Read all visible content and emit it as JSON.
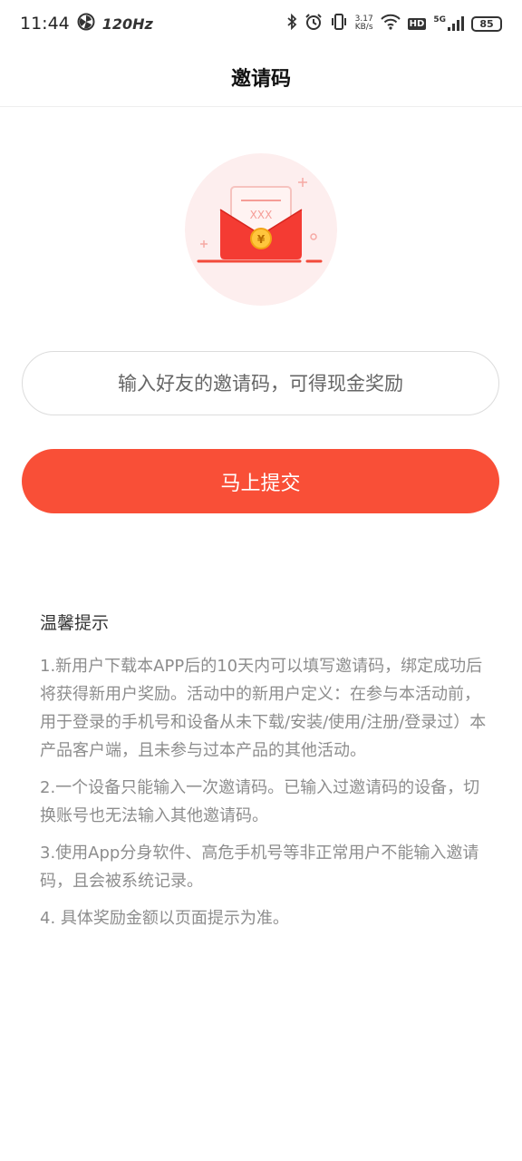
{
  "status_bar": {
    "time": "11:44",
    "refresh_rate": "120Hz",
    "net_speed_value": "3.17",
    "net_speed_unit": "KB/s",
    "hd_label": "HD",
    "network_type": "5G",
    "battery": "85"
  },
  "header": {
    "title": "邀请码"
  },
  "hero": {
    "icon": "red-envelope-icon",
    "letter_text": "XXX",
    "coin_symbol": "¥"
  },
  "form": {
    "input_placeholder": "输入好友的邀请码，可得现金奖励",
    "input_value": "",
    "submit_label": "马上提交"
  },
  "tips": {
    "title": "温馨提示",
    "items": [
      "1.新用户下载本APP后的10天内可以填写邀请码，绑定成功后将获得新用户奖励。活动中的新用户定义：在参与本活动前，用于登录的手机号和设备从未下载/安装/使用/注册/登录过）本产品客户端，且未参与过本产品的其他活动。",
      "2.一个设备只能输入一次邀请码。已输入过邀请码的设备，切换账号也无法输入其他邀请码。",
      "3.使用App分身软件、高危手机号等非正常用户不能输入邀请码，且会被系统记录。",
      "4. 具体奖励金额以页面提示为准。"
    ]
  },
  "colors": {
    "accent": "#f94f37",
    "envelope": "#f43b33",
    "hero_bg": "#fdeeee",
    "tip_text": "#8d8d8d"
  }
}
